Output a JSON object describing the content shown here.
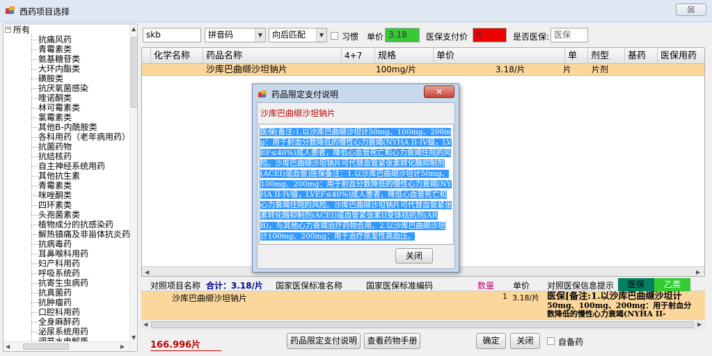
{
  "window": {
    "title": "西药项目选择",
    "close_glyph": "☒"
  },
  "tree": {
    "root": "所有",
    "items": [
      "抗痛风药",
      "青霉素类",
      "氨基糖苷类",
      "大环内酯类",
      "磺胺类",
      "抗厌氧菌感染",
      "喹诺酮类",
      "林可霉素类",
      "氯霉素类",
      "其他B-内酰胺类",
      "各科用药（老年病用药）",
      "抗菌药物",
      "抗结核药",
      "自主神经系统用药",
      "其他抗生素",
      "青霉素类",
      "咪唑酮类",
      "四环素类",
      "头孢菌素类",
      "植物成分的抗感染药",
      "解热镇痛及非甾体抗炎药",
      "抗病毒药",
      "耳鼻喉科用药",
      "妇产科用药",
      "呼吸系统药",
      "抗寄生虫病药",
      "抗真菌药",
      "抗肿瘤药",
      "口腔科用药",
      "全身麻醉药",
      "泌尿系统用药",
      "调节水电解质"
    ]
  },
  "toolbar": {
    "search_value": "skb",
    "match_mode": "拼音码",
    "match_position": "向后匹配",
    "habit_label": "习惯",
    "price_label": "单价",
    "price_value": "3.18",
    "insurance_price_label": "医保支付价",
    "insurance_price_value": "0",
    "is_insurance_label": "是否医保:",
    "is_insurance_value": "医保",
    "price_color": "#38c838",
    "insurance_price_color": "#ee0000"
  },
  "grid": {
    "columns": [
      "化学名称",
      "药品名称",
      "4+7",
      "规格",
      "单价",
      "单",
      "剂型",
      "基药",
      "医保用药"
    ],
    "row": {
      "name": "沙库巴曲缬沙坦钠片",
      "spec": "100mg/片",
      "price": "3.18/片",
      "unit": "片",
      "form": "片剂"
    }
  },
  "lower": {
    "h_item": "对照项目名称",
    "h_total": "合计：3.18/片",
    "h_std_name": "国家医保标准名称",
    "h_std_code": "国家医保标准编码",
    "h_qty": "数量",
    "h_price": "单价",
    "h_info": "对照医保信息提示",
    "tag_insurance": "医保",
    "tag_class": "乙类",
    "row": {
      "name": "沙库巴曲缬沙坦钠片",
      "qty": "1",
      "price": "3.18/片",
      "info_line1": "医保[备注:1.以沙库巴曲缬沙坦计",
      "info_line2": "50mg、100mg、200mg：用于射血分",
      "info_line3": "数降低的慢性心力衰竭(NYHA II-"
    }
  },
  "footer": {
    "total": "166.996片",
    "btn_limit": "药品限定支付说明",
    "btn_manual": "查看药物手册",
    "btn_ok": "确定",
    "btn_close": "关闭",
    "self_pay": "自备药"
  },
  "dialog": {
    "title": "药品限定支付说明",
    "drug_name": "沙库巴曲缬沙坦钠片",
    "text": "医保[备注:1.以沙库巴曲缬沙坦计50mg、100mg、200mg：用于射血分数降低的慢性心力衰竭(NYHA II-IV级，LVEF≤40%)成人患者，降低心血管死亡和心力衰竭住院的风险。沙库巴曲缬沙坦钠片可代替血管紧张素转化酶抑制剂(ACEI)或血管]医保备注：1.以沙库巴曲缬沙坦计50mg、100mg、200mg：用于射血分数降低的慢性心力衰竭(NYHA II-IV级，LVEF≤40%)成人患者，降低心血管死亡和心力衰竭住院的风险。沙库巴曲缬沙坦钠片可代替血管紧张素转化酶抑制剂(ACEI)或血管紧张素II受体拮抗剂(ARB)，与其他心力衰竭治疗药物合用。2.以沙库巴曲缬沙坦计100mg、200mg：用于治疗原发性高血压。",
    "close_glyph": "✕",
    "btn_close": "关闭"
  }
}
